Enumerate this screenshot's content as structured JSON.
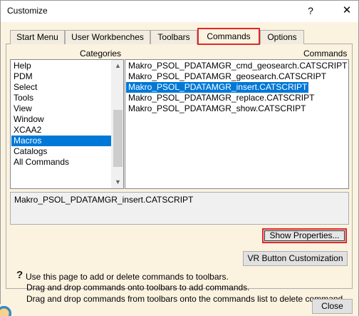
{
  "window": {
    "title": "Customize",
    "help_glyph": "?",
    "close_glyph": "✕"
  },
  "tabs": [
    {
      "label": "Start Menu",
      "active": false
    },
    {
      "label": "User Workbenches",
      "active": false
    },
    {
      "label": "Toolbars",
      "active": false
    },
    {
      "label": "Commands",
      "active": true
    },
    {
      "label": "Options",
      "active": false
    }
  ],
  "categories": {
    "label": "Categories",
    "items": [
      "Help",
      "PDM",
      "Select",
      "Tools",
      "View",
      "Window",
      "XCAA2",
      "Macros",
      "Catalogs",
      "All Commands"
    ],
    "selected": "Macros",
    "scroll_up_glyph": "▲",
    "scroll_down_glyph": "▼"
  },
  "commands": {
    "label": "Commands",
    "items": [
      "Makro_PSOL_PDATAMGR_cmd_geosearch.CATSCRIPT",
      "Makro_PSOL_PDATAMGR_geosearch.CATSCRIPT",
      "Makro_PSOL_PDATAMGR_insert.CATSCRIPT",
      "Makro_PSOL_PDATAMGR_replace.CATSCRIPT",
      "Makro_PSOL_PDATAMGR_show.CATSCRIPT"
    ],
    "selected": "Makro_PSOL_PDATAMGR_insert.CATSCRIPT"
  },
  "description": "Makro_PSOL_PDATAMGR_insert.CATSCRIPT",
  "buttons": {
    "show_properties": "Show Properties...",
    "vr_customization": "VR Button Customization",
    "close": "Close"
  },
  "info": {
    "icon": "?",
    "line1": "Use this page to add or delete commands to toolbars.",
    "line2": "Drag and drop commands onto toolbars to add commands.",
    "line3": "Drag and drop commands from toolbars onto the commands list to delete command."
  },
  "colors": {
    "highlight_outline": "#e0282a",
    "selection": "#0078d7",
    "dialog_bg": "#fbf3e0"
  }
}
